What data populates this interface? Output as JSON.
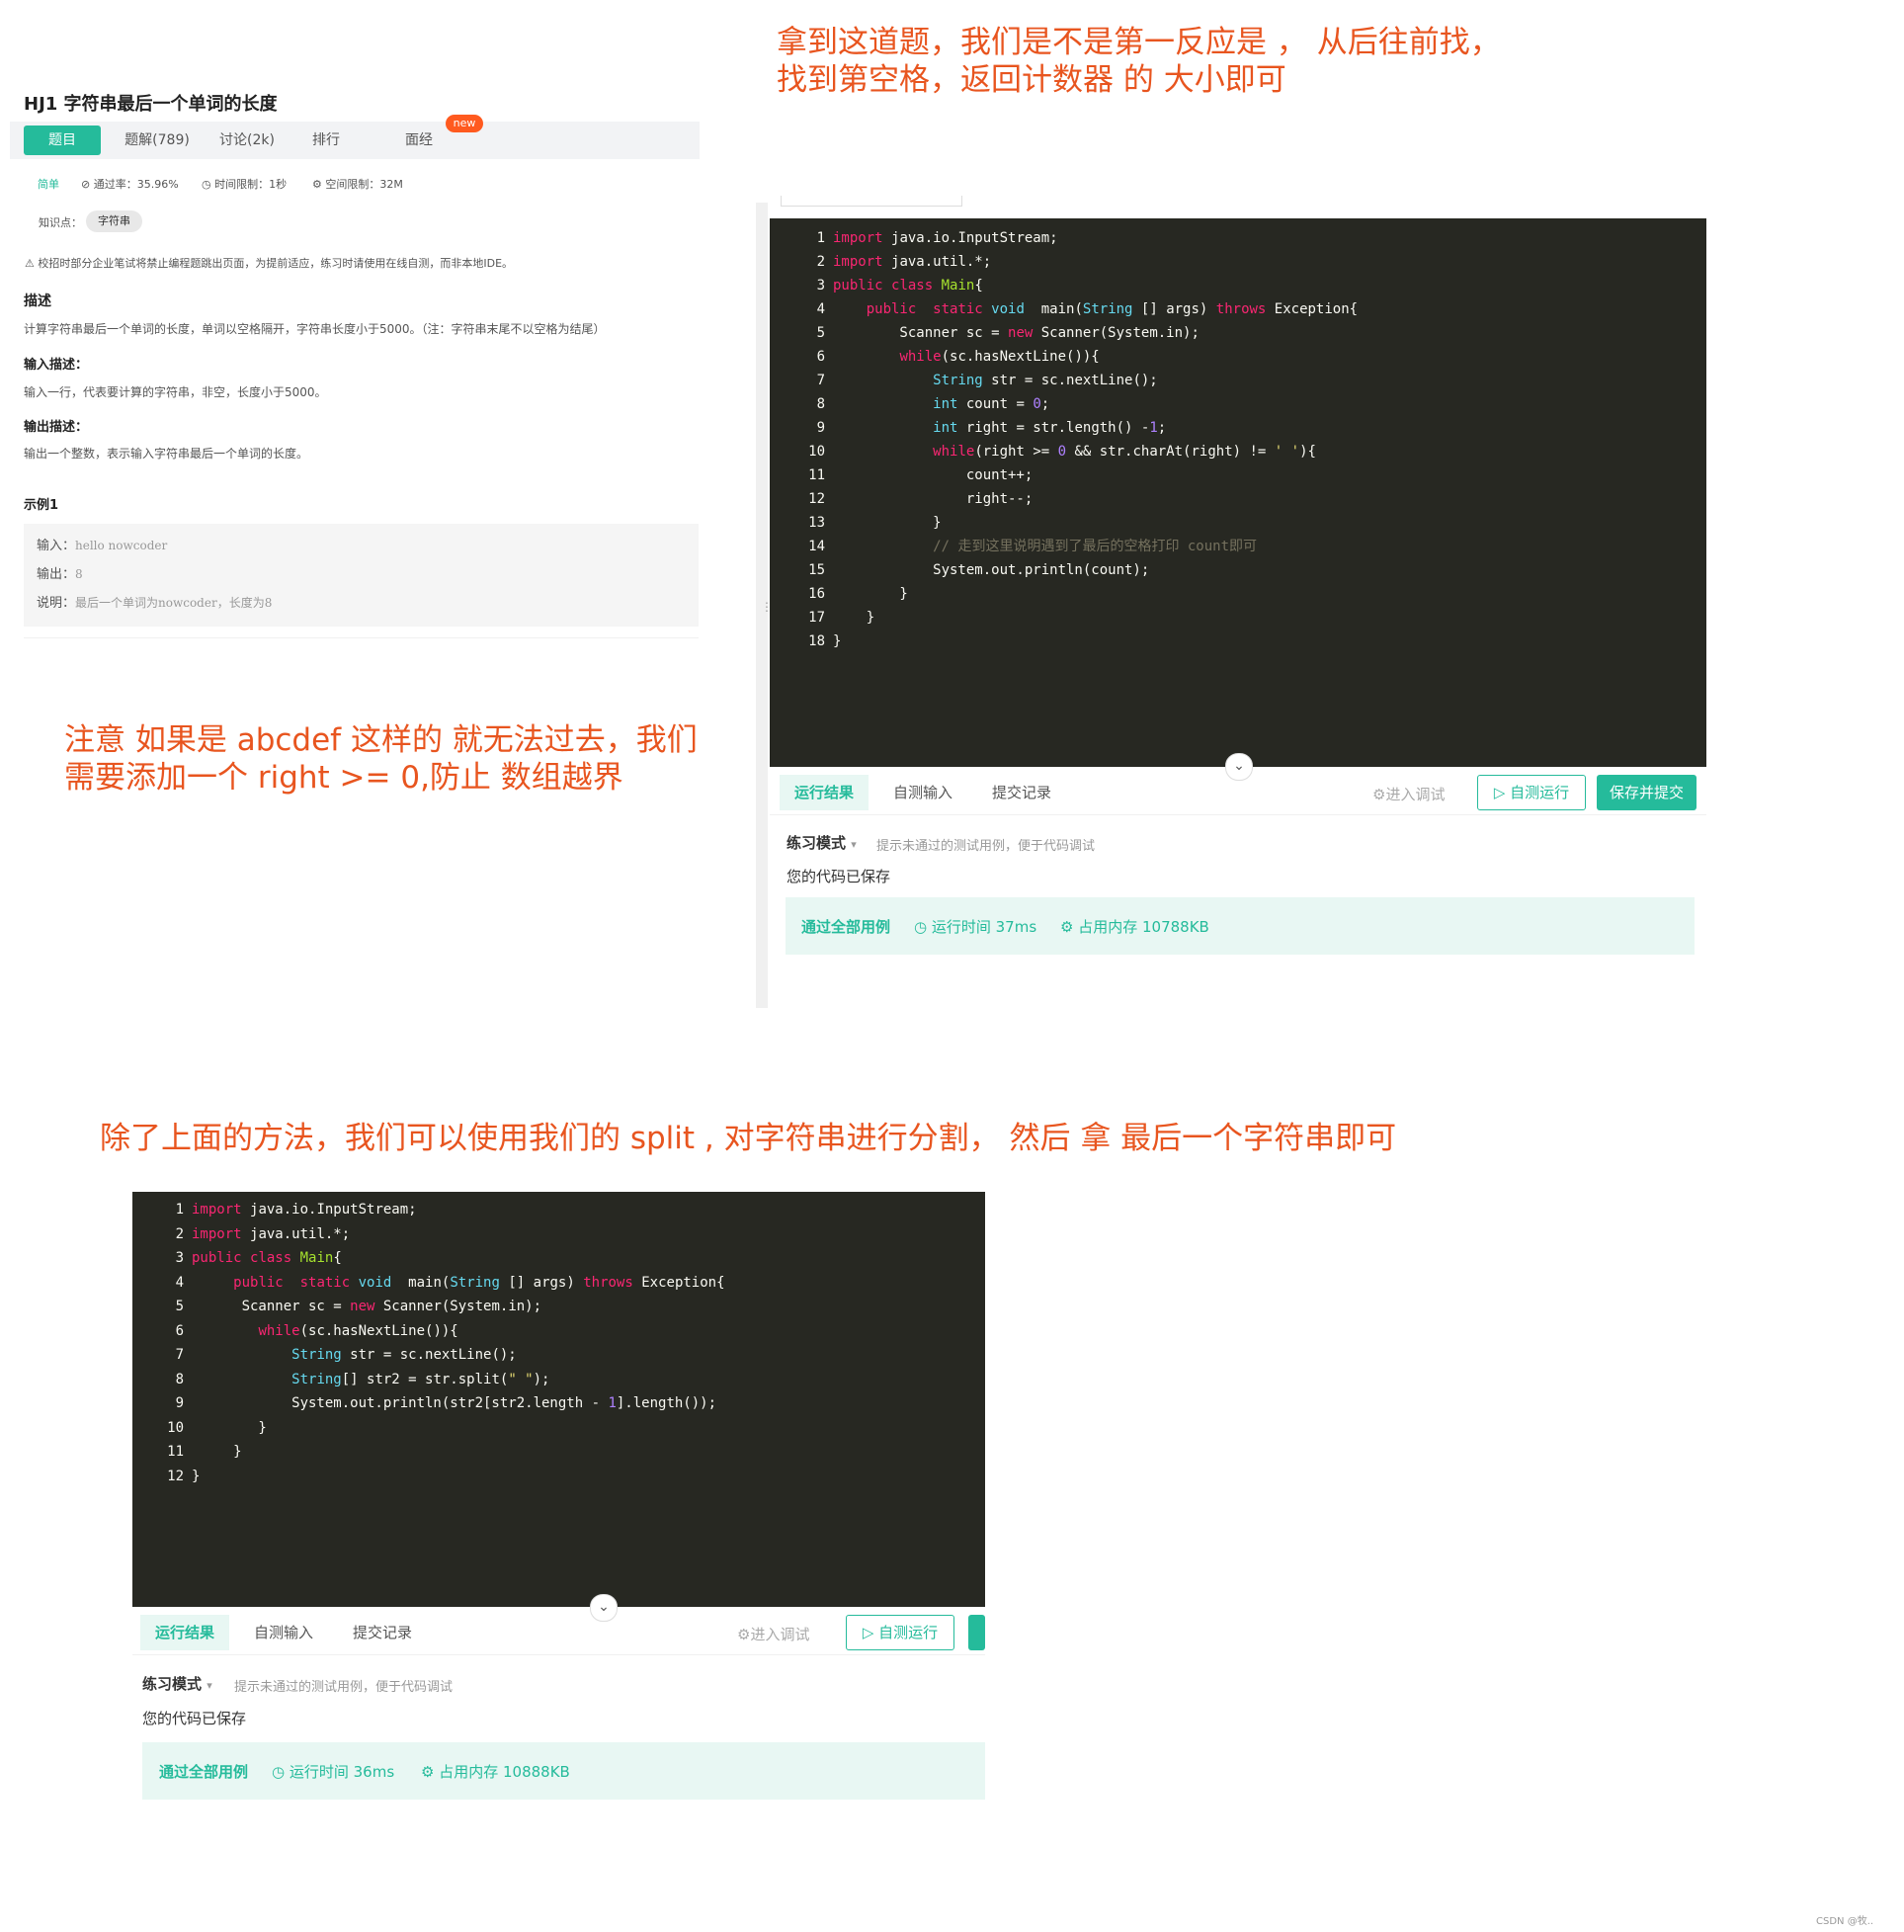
{
  "notes": {
    "top_right_1": "拿到这道题，我们是不是第一反应是 ， 从后往前找，",
    "top_right_2": "找到第空格，返回计数器 的 大小即可",
    "left_1": "注意 如果是  abcdef 这样的 就无法过去，我们",
    "left_2": "需要添加一个 right >= 0,防止 数组越界",
    "middle": "除了上面的方法，我们可以使用我们的 split , 对字符串进行分割，  然后 拿 最后一个字符串即可"
  },
  "problem": {
    "title": "HJ1  字符串最后一个单词的长度",
    "tabs": [
      "题目",
      "题解(789)",
      "讨论(2k)",
      "排行",
      "面经"
    ],
    "new_badge": "new",
    "difficulty": "简单",
    "pass_rate": "⊘ 通过率：35.96%",
    "time_limit": "◷ 时间限制：1秒",
    "space_limit": "⚙ 空间限制：32M",
    "knowledge_label": "知识点：",
    "knowledge_tag": "字符串",
    "warning": "⚠ 校招时部分企业笔试将禁止编程题跳出页面，为提前适应，练习时请使用在线自测，而非本地IDE。",
    "desc_title": "描述",
    "desc": "计算字符串最后一个单词的长度，单词以空格隔开，字符串长度小于5000。（注：字符串末尾不以空格为结尾）",
    "input_title": "输入描述：",
    "input_desc": "输入一行，代表要计算的字符串，非空，长度小于5000。",
    "output_title": "输出描述：",
    "output_desc": "输出一个整数，表示输入字符串最后一个单词的长度。",
    "example_title": "示例1",
    "example_input_label": "输入：",
    "example_input": "hello nowcoder",
    "example_output_label": "输出：",
    "example_output": "8",
    "example_note_label": "说明：",
    "example_note": "最后一个单词为nowcoder，长度为8"
  },
  "editor1": {
    "result_tabs": [
      "运行结果",
      "自测输入",
      "提交记录"
    ],
    "debug": "⚙进入调试",
    "run": "▷ 自测运行",
    "submit": "保存并提交",
    "mode": "练习模式",
    "mode_hint": "提示未通过的测试用例，便于代码调试",
    "saved": "您的代码已保存",
    "pass": "通过全部用例",
    "runtime": "◷ 运行时间 37ms",
    "memory": "⚙ 占用内存 10788KB"
  },
  "editor2": {
    "result_tabs": [
      "运行结果",
      "自测输入",
      "提交记录"
    ],
    "debug": "⚙进入调试",
    "run": "▷ 自测运行",
    "mode": "练习模式",
    "mode_hint": "提示未通过的测试用例，便于代码调试",
    "saved": "您的代码已保存",
    "pass": "通过全部用例",
    "runtime": "◷ 运行时间 36ms",
    "memory": "⚙ 占用内存 10888KB"
  },
  "code1": [
    [
      [
        "kw",
        "import"
      ],
      [
        "",
        "java.io.InputStream;"
      ]
    ],
    [
      [
        "kw",
        "import"
      ],
      [
        "",
        "java.util.*;"
      ]
    ],
    [
      [
        "kw",
        "public"
      ],
      [
        "",
        ""
      ],
      [
        "kw",
        "class"
      ],
      [
        "",
        ""
      ],
      [
        "cls",
        "Main"
      ],
      [
        "",
        "{"
      ]
    ],
    [
      [
        "",
        "    "
      ],
      [
        "kw",
        "public"
      ],
      [
        "",
        "  "
      ],
      [
        "kw",
        "static"
      ],
      [
        "",
        ""
      ],
      [
        "ty",
        "void"
      ],
      [
        "",
        "  main("
      ],
      [
        "ty",
        "String"
      ],
      [
        "",
        " [] args) "
      ],
      [
        "kw",
        "throws"
      ],
      [
        "",
        " Exception{"
      ]
    ],
    [
      [
        "",
        "        Scanner sc = "
      ],
      [
        "kw",
        "new"
      ],
      [
        "",
        " Scanner(System.in);"
      ]
    ],
    [
      [
        "",
        "        "
      ],
      [
        "kw",
        "while"
      ],
      [
        "",
        "(sc.hasNextLine()){"
      ]
    ],
    [
      [
        "",
        "            "
      ],
      [
        "ty",
        "String"
      ],
      [
        "",
        " str = sc.nextLine();"
      ]
    ],
    [
      [
        "",
        "            "
      ],
      [
        "ty",
        "int"
      ],
      [
        "",
        " count = "
      ],
      [
        "num",
        "0"
      ],
      [
        "",
        ";"
      ]
    ],
    [
      [
        "",
        "            "
      ],
      [
        "ty",
        "int"
      ],
      [
        "",
        " right = str.length() -"
      ],
      [
        "num",
        "1"
      ],
      [
        "",
        ";"
      ]
    ],
    [
      [
        "",
        "            "
      ],
      [
        "kw",
        "while"
      ],
      [
        "",
        "(right >= "
      ],
      [
        "num",
        "0"
      ],
      [
        "",
        " && str.charAt(right) != "
      ],
      [
        "str",
        "' '"
      ],
      [
        "",
        "){"
      ]
    ],
    [
      [
        "",
        "                count++;"
      ]
    ],
    [
      [
        "",
        "                right--;"
      ]
    ],
    [
      [
        "",
        "            }"
      ]
    ],
    [
      [
        "",
        "            "
      ],
      [
        "cm",
        "// 走到这里说明遇到了最后的空格打印 count即可"
      ]
    ],
    [
      [
        "",
        "            System.out.println(count);"
      ]
    ],
    [
      [
        "",
        "        }"
      ]
    ],
    [
      [
        "",
        "    }"
      ]
    ],
    [
      [
        "",
        "}"
      ]
    ]
  ],
  "code2": [
    [
      [
        "kw",
        "import"
      ],
      [
        "",
        "java.io.InputStream;"
      ]
    ],
    [
      [
        "kw",
        "import"
      ],
      [
        "",
        "java.util.*;"
      ]
    ],
    [
      [
        "kw",
        "public"
      ],
      [
        "",
        ""
      ],
      [
        "kw",
        "class"
      ],
      [
        "",
        ""
      ],
      [
        "cls",
        "Main"
      ],
      [
        "",
        "{"
      ]
    ],
    [
      [
        "",
        "     "
      ],
      [
        "kw",
        "public"
      ],
      [
        "",
        "  "
      ],
      [
        "kw",
        "static"
      ],
      [
        "",
        ""
      ],
      [
        "ty",
        "void"
      ],
      [
        "",
        "  main("
      ],
      [
        "ty",
        "String"
      ],
      [
        "",
        " [] args) "
      ],
      [
        "kw",
        "throws"
      ],
      [
        "",
        " Exception{"
      ]
    ],
    [
      [
        "",
        "      Scanner sc = "
      ],
      [
        "kw",
        "new"
      ],
      [
        "",
        " Scanner(System.in);"
      ]
    ],
    [
      [
        "",
        "        "
      ],
      [
        "kw",
        "while"
      ],
      [
        "",
        "(sc.hasNextLine()){"
      ]
    ],
    [
      [
        "",
        "            "
      ],
      [
        "ty",
        "String"
      ],
      [
        "",
        " str = sc.nextLine();"
      ]
    ],
    [
      [
        "",
        "            "
      ],
      [
        "ty",
        "String"
      ],
      [
        "",
        "[] str2 = str.split("
      ],
      [
        "str",
        "\" \""
      ],
      [
        "",
        ");"
      ]
    ],
    [
      [
        "",
        "            System.out.println(str2[str2.length - "
      ],
      [
        "num",
        "1"
      ],
      [
        "",
        "].length());"
      ]
    ],
    [
      [
        "",
        "        }"
      ]
    ],
    [
      [
        "",
        "     }"
      ]
    ],
    [
      [
        "",
        "}"
      ]
    ]
  ],
  "footer": "CSDN @牧.."
}
